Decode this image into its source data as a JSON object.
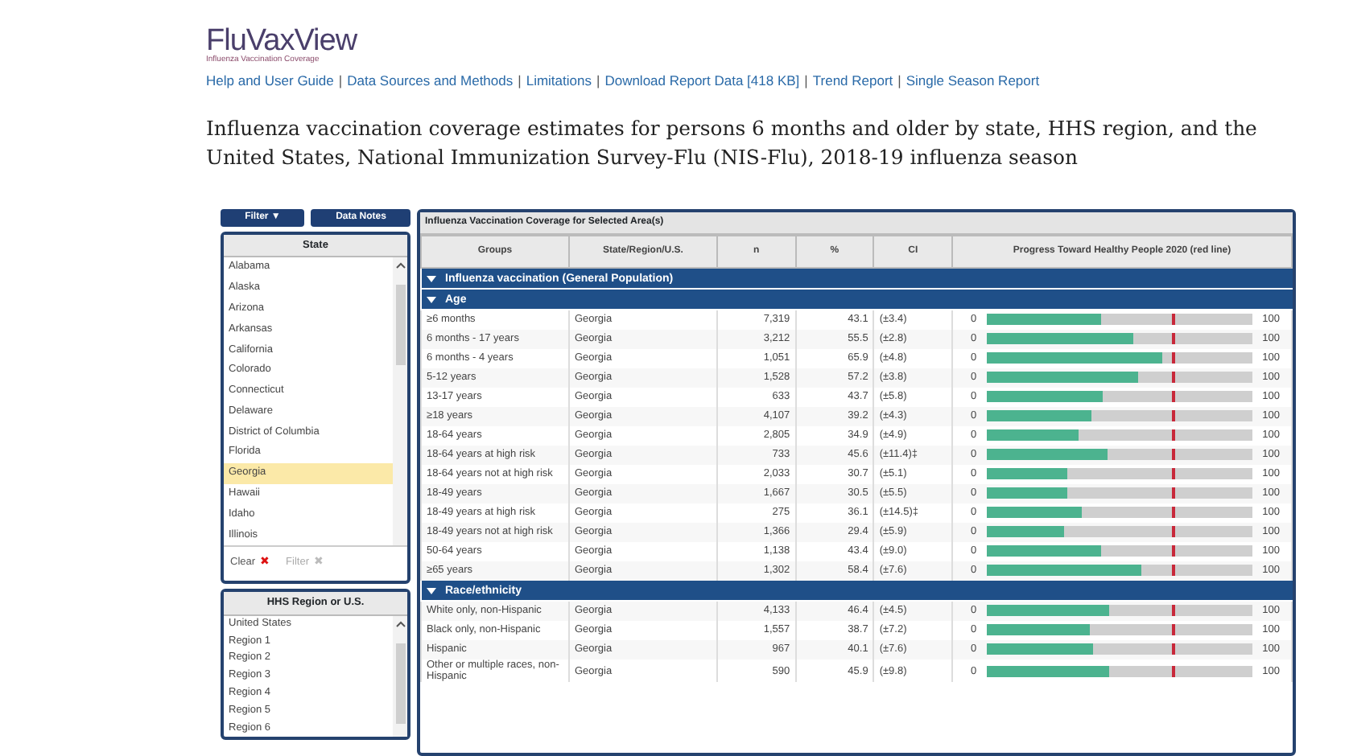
{
  "logo": {
    "name": "FluVaxView",
    "tagline": "Influenza Vaccination Coverage"
  },
  "nav_separator": "|",
  "nav_links": [
    "Help and User Guide",
    "Data Sources and Methods",
    "Limitations",
    "Download Report Data [418 KB]",
    "Trend Report",
    "Single Season Report"
  ],
  "title": "Influenza vaccination coverage estimates for persons 6 months and older by state, HHS region, and the United States, National Immunization Survey-Flu (NIS-Flu), 2018-19 influenza season",
  "filter_button": {
    "label": "Filter",
    "caret": "▼"
  },
  "data_notes_button": "Data Notes",
  "state_list": {
    "heading": "State",
    "items": [
      {
        "label": "Alabama",
        "selected": false
      },
      {
        "label": "Alaska",
        "selected": false
      },
      {
        "label": "Arizona",
        "selected": false
      },
      {
        "label": "Arkansas",
        "selected": false
      },
      {
        "label": "California",
        "selected": false
      },
      {
        "label": "Colorado",
        "selected": false
      },
      {
        "label": "Connecticut",
        "selected": false
      },
      {
        "label": "Delaware",
        "selected": false
      },
      {
        "label": "District of Columbia",
        "selected": false
      },
      {
        "label": "Florida",
        "selected": false
      },
      {
        "label": "Georgia",
        "selected": true
      },
      {
        "label": "Hawaii",
        "selected": false
      },
      {
        "label": "Idaho",
        "selected": false
      },
      {
        "label": "Illinois",
        "selected": false
      }
    ],
    "actions": [
      {
        "label": "Clear",
        "icon": "✖",
        "disabled": false
      },
      {
        "label": "Filter",
        "icon": "✖",
        "disabled": true
      }
    ]
  },
  "region_list": {
    "heading": "HHS Region or U.S.",
    "items": [
      {
        "label": "United States",
        "selected": false
      },
      {
        "label": "Region 1",
        "selected": false
      },
      {
        "label": "Region 2",
        "selected": false
      },
      {
        "label": "Region 3",
        "selected": false
      },
      {
        "label": "Region 4",
        "selected": false
      },
      {
        "label": "Region 5",
        "selected": false
      },
      {
        "label": "Region 6",
        "selected": false
      }
    ]
  },
  "table": {
    "caption": "Influenza Vaccination Coverage for Selected Area(s)",
    "columns": [
      "Groups",
      "State/Region/U.S.",
      "n",
      "%",
      "CI",
      "Progress Toward Healthy People 2020 (red line)"
    ],
    "sections": [
      {
        "title": "Influenza vaccination (General Population)",
        "expanded": true,
        "children": [
          {
            "title": "Age",
            "expanded": true,
            "rows": [
              {
                "group": "≥6 months",
                "area": "Georgia",
                "n": "7,319",
                "pct": "43.1",
                "ci": "(±3.4)",
                "min": "0",
                "max": "100",
                "level": 0.431
              },
              {
                "group": "6 months - 17 years",
                "area": "Georgia",
                "n": "3,212",
                "pct": "55.5",
                "ci": "(±2.8)",
                "min": "0",
                "max": "100",
                "level": 0.555
              },
              {
                "group": "6 months - 4 years",
                "area": "Georgia",
                "n": "1,051",
                "pct": "65.9",
                "ci": "(±4.8)",
                "min": "0",
                "max": "100",
                "level": 0.659
              },
              {
                "group": "5-12 years",
                "area": "Georgia",
                "n": "1,528",
                "pct": "57.2",
                "ci": "(±3.8)",
                "min": "0",
                "max": "100",
                "level": 0.572
              },
              {
                "group": "13-17 years",
                "area": "Georgia",
                "n": "633",
                "pct": "43.7",
                "ci": "(±5.8)",
                "min": "0",
                "max": "100",
                "level": 0.437
              },
              {
                "group": "≥18 years",
                "area": "Georgia",
                "n": "4,107",
                "pct": "39.2",
                "ci": "(±4.3)",
                "min": "0",
                "max": "100",
                "level": 0.392
              },
              {
                "group": "18-64 years",
                "area": "Georgia",
                "n": "2,805",
                "pct": "34.9",
                "ci": "(±4.9)",
                "min": "0",
                "max": "100",
                "level": 0.349
              },
              {
                "group": "18-64 years at high risk",
                "area": "Georgia",
                "n": "733",
                "pct": "45.6",
                "ci": "(±11.4)‡",
                "min": "0",
                "max": "100",
                "level": 0.456
              },
              {
                "group": "18-64 years not at high risk",
                "area": "Georgia",
                "n": "2,033",
                "pct": "30.7",
                "ci": "(±5.1)",
                "min": "0",
                "max": "100",
                "level": 0.307
              },
              {
                "group": "18-49 years",
                "area": "Georgia",
                "n": "1,667",
                "pct": "30.5",
                "ci": "(±5.5)",
                "min": "0",
                "max": "100",
                "level": 0.305
              },
              {
                "group": "18-49 years at high risk",
                "area": "Georgia",
                "n": "275",
                "pct": "36.1",
                "ci": "(±14.5)‡",
                "min": "0",
                "max": "100",
                "level": 0.361
              },
              {
                "group": "18-49 years not at high risk",
                "area": "Georgia",
                "n": "1,366",
                "pct": "29.4",
                "ci": "(±5.9)",
                "min": "0",
                "max": "100",
                "level": 0.294
              },
              {
                "group": "50-64 years",
                "area": "Georgia",
                "n": "1,138",
                "pct": "43.4",
                "ci": "(±9.0)",
                "min": "0",
                "max": "100",
                "level": 0.434
              },
              {
                "group": "≥65 years",
                "area": "Georgia",
                "n": "1,302",
                "pct": "58.4",
                "ci": "(±7.6)",
                "min": "0",
                "max": "100",
                "level": 0.584
              }
            ]
          },
          {
            "title": "Race/ethnicity",
            "expanded": true,
            "rows": [
              {
                "group": "White only, non-Hispanic",
                "area": "Georgia",
                "n": "4,133",
                "pct": "46.4",
                "ci": "(±4.5)",
                "min": "0",
                "max": "100",
                "level": 0.464
              },
              {
                "group": "Black only, non-Hispanic",
                "area": "Georgia",
                "n": "1,557",
                "pct": "38.7",
                "ci": "(±7.2)",
                "min": "0",
                "max": "100",
                "level": 0.387
              },
              {
                "group": "Hispanic",
                "area": "Georgia",
                "n": "967",
                "pct": "40.1",
                "ci": "(±7.6)",
                "min": "0",
                "max": "100",
                "level": 0.401
              },
              {
                "group": "Other or multiple races, non-Hispanic",
                "area": "Georgia",
                "n": "590",
                "pct": "45.9",
                "ci": "(±9.8)",
                "min": "0",
                "max": "100",
                "level": 0.459
              }
            ]
          }
        ]
      }
    ]
  }
}
